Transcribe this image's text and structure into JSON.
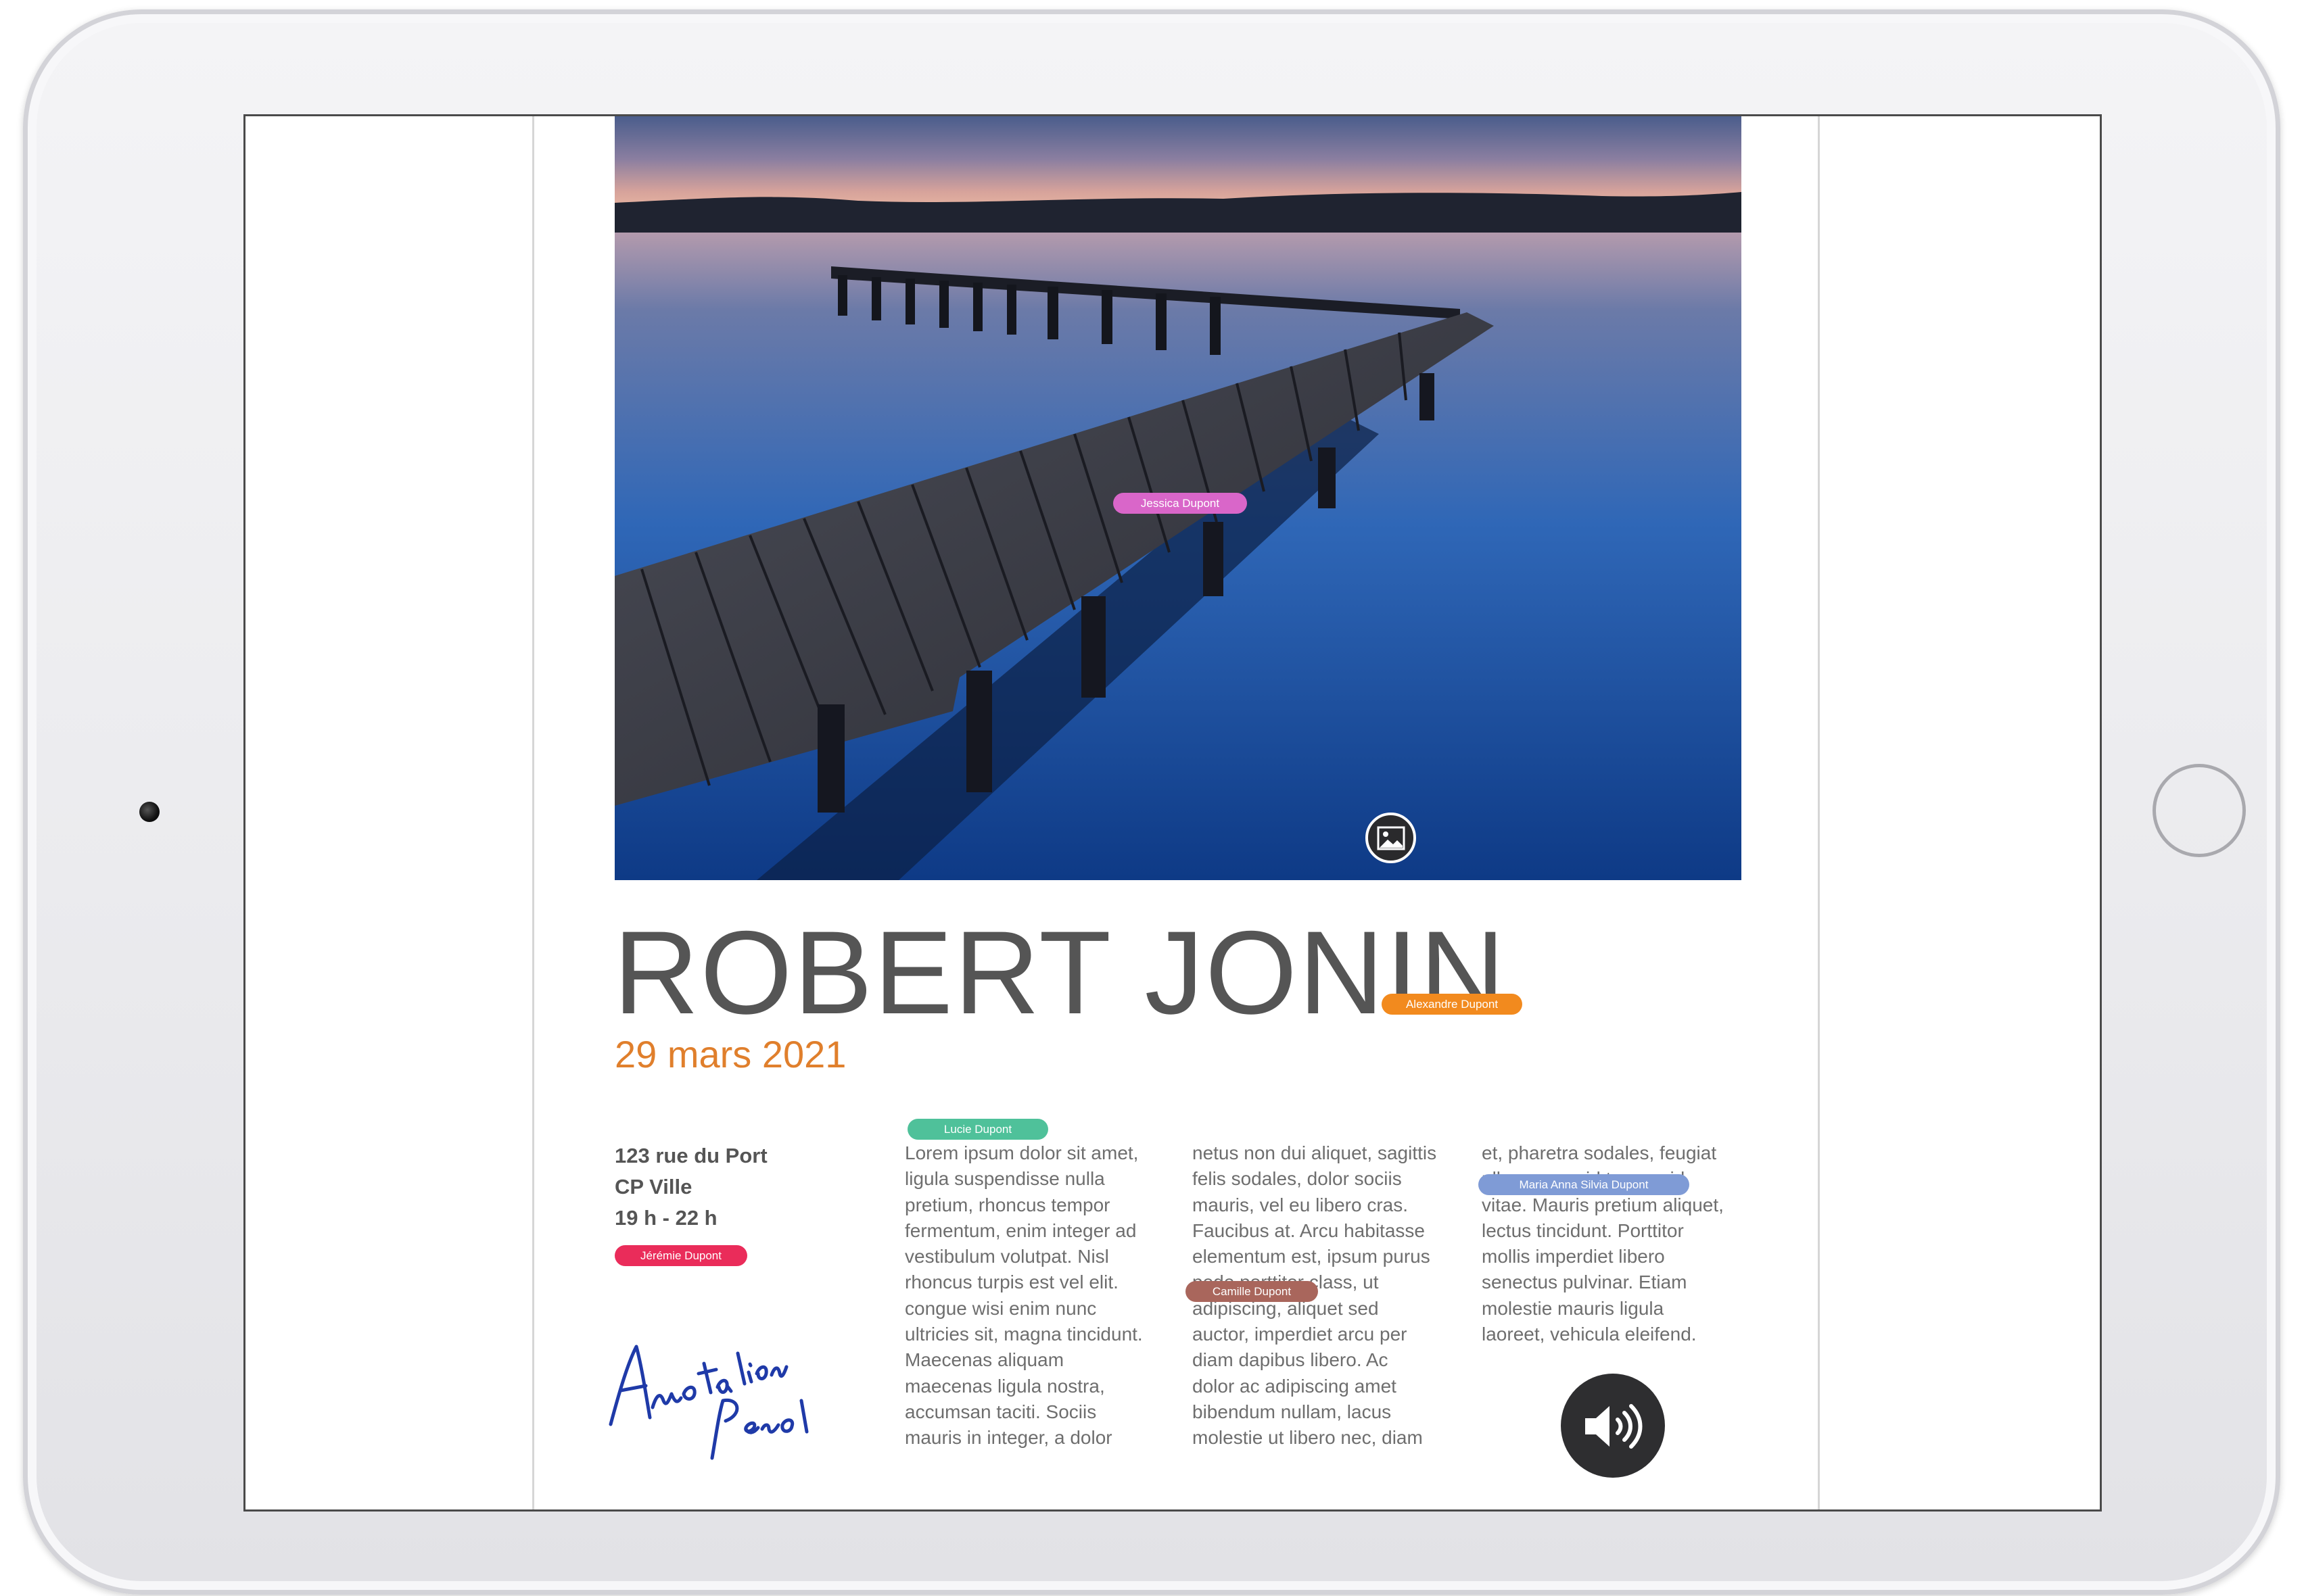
{
  "document": {
    "title": "ROBERT JONIN",
    "date": "29 mars 2021",
    "address_lines": [
      "123 rue du Port",
      "CP Ville",
      "19 h - 22 h"
    ],
    "columns": [
      [
        "Lorem ipsum dolor sit amet,",
        "ligula suspendisse nulla",
        "pretium, rhoncus tempor",
        "fermentum, enim integer ad",
        "vestibulum volutpat. Nisl",
        "rhoncus turpis est vel elit.",
        "congue wisi enim nunc",
        "ultricies sit, magna tincidunt.",
        "Maecenas aliquam",
        "maecenas ligula nostra,",
        "accumsan taciti. Sociis",
        "mauris in integer, a dolor"
      ],
      [
        "netus non dui aliquet, sagittis",
        "felis sodales, dolor sociis",
        "mauris, vel eu libero cras.",
        "Faucibus at. Arcu habitasse",
        "elementum est, ipsum purus",
        "pede porttitor class, ut",
        "adipiscing, aliquet sed",
        "auctor, imperdiet arcu per",
        "diam dapibus libero. Ac",
        "dolor ac adipiscing amet",
        "bibendum nullam, lacus",
        "molestie ut libero nec, diam"
      ],
      [
        "et, pharetra sodales, feugiat",
        "ullamcorper id tempor id",
        "vitae. Mauris pretium aliquet,",
        "lectus tincidunt. Porttitor",
        "mollis imperdiet libero",
        "senectus pulvinar. Etiam",
        "molestie mauris ligula",
        "laoreet, vehicula eleifend."
      ]
    ]
  },
  "collaborators": {
    "jessica": {
      "name": "Jessica Dupont",
      "color": "#d966c9"
    },
    "alexandre": {
      "name": "Alexandre Dupont",
      "color": "#f28a1e"
    },
    "lucie": {
      "name": "Lucie Dupont",
      "color": "#4fc19a"
    },
    "maria": {
      "name": "Maria Anna Silvia Dupont",
      "color": "#7f9bd6"
    },
    "jeremie": {
      "name": "Jérémie Dupont",
      "color": "#ea2c5a"
    },
    "camille": {
      "name": "Camille Dupont",
      "color": "#a9665c"
    }
  },
  "annotation": {
    "handwriting": "Annotation Pencil",
    "ink_color": "#1f3aa8"
  },
  "icons": {
    "image_badge": "image-icon",
    "sound": "speaker-icon"
  }
}
